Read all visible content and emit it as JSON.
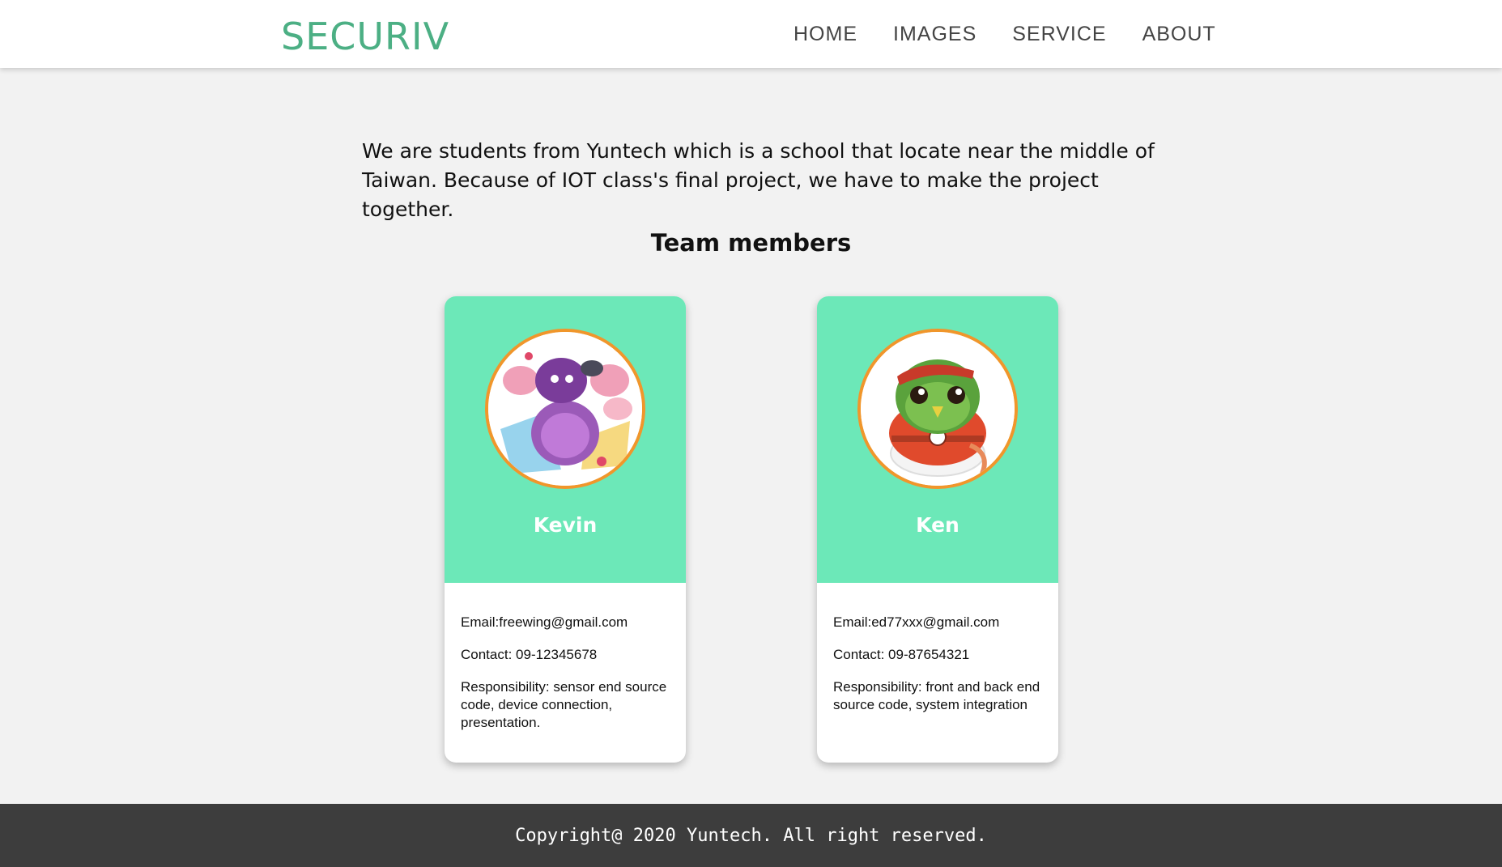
{
  "header": {
    "brand": "SECURIV",
    "nav": [
      "HOME",
      "IMAGES",
      "SERVICE",
      "ABOUT"
    ]
  },
  "intro": {
    "text": "We are students from Yuntech which is a school that locate near the middle of Taiwan. Because of IOT class's final project, we have to make the project together."
  },
  "team": {
    "heading": "Team members",
    "members": [
      {
        "name": "Kevin",
        "email": "Email:freewing@gmail.com",
        "contact": "Contact: 09-12345678",
        "responsibility": "Responsibility: sensor end source code, device connection, presentation."
      },
      {
        "name": "Ken",
        "email": "Email:ed77xxx@gmail.com",
        "contact": "Contact: 09-87654321",
        "responsibility": "Responsibility: front and back end source code, system integration"
      }
    ]
  },
  "footer": {
    "copyright": "Copyright@ 2020 Yuntech. All right reserved."
  },
  "colors": {
    "brand": "#4caf84",
    "card_top": "#6ce8b8",
    "avatar_border": "#f0962b",
    "footer_bg": "#3d3d3d",
    "page_bg": "#f2f2f2"
  }
}
